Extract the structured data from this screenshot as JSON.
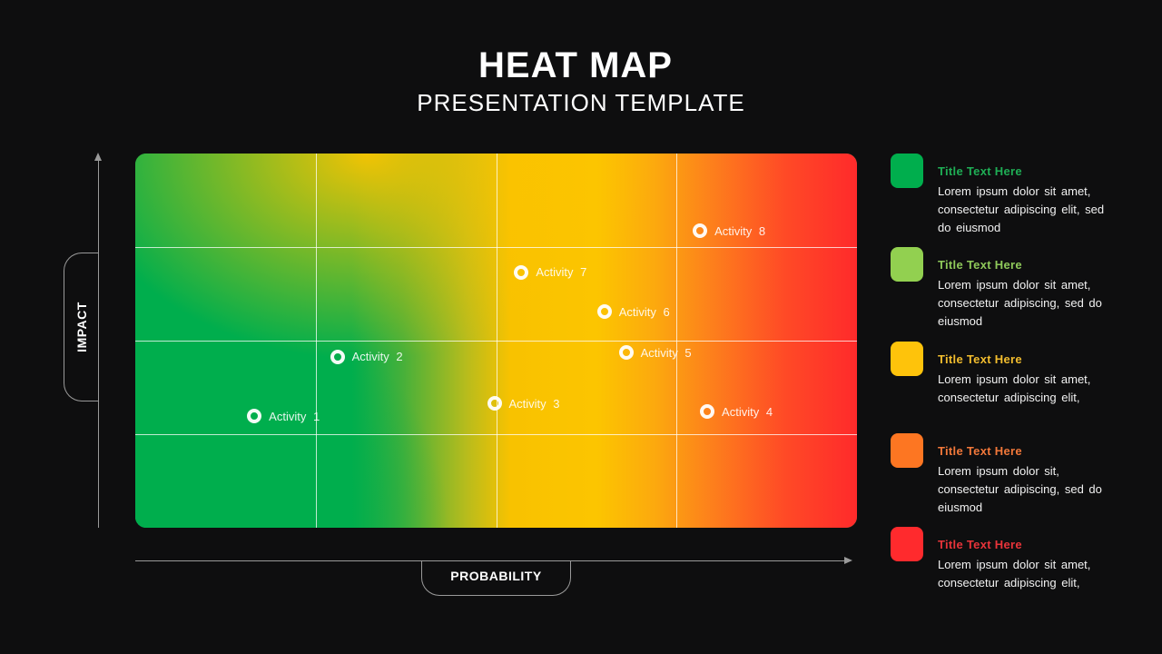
{
  "header": {
    "title": "HEAT MAP",
    "subtitle": "PRESENTATION TEMPLATE"
  },
  "chart_data": {
    "type": "heatmap",
    "title": "HEAT MAP",
    "subtitle": "PRESENTATION TEMPLATE",
    "xlabel": "PROBABILITY",
    "ylabel": "IMPACT",
    "xlim": [
      0,
      4
    ],
    "ylim": [
      0,
      4
    ],
    "grid": true,
    "grid_divisions": {
      "columns": 4,
      "rows": 4
    },
    "color_scale": [
      "#00ae4d",
      "#92d050",
      "#fcc200",
      "#fd7b22",
      "#ff2a2b"
    ],
    "color_direction": "green at low probability/low impact, red at high probability",
    "points": [
      {
        "label": "Activity 1",
        "x": 0.66,
        "y": 1.19
      },
      {
        "label": "Activity 2",
        "x": 1.12,
        "y": 1.83
      },
      {
        "label": "Activity 3",
        "x": 1.99,
        "y": 1.33
      },
      {
        "label": "Activity 4",
        "x": 3.17,
        "y": 1.24
      },
      {
        "label": "Activity 5",
        "x": 2.72,
        "y": 1.87
      },
      {
        "label": "Activity 6",
        "x": 2.6,
        "y": 2.31
      },
      {
        "label": "Activity 7",
        "x": 2.14,
        "y": 2.73
      },
      {
        "label": "Activity 8",
        "x": 3.13,
        "y": 3.17
      }
    ]
  },
  "legend": [
    {
      "title": "Title Text Here",
      "color": "#00ae4d",
      "title_color": "#1fae55",
      "text": "Lorem ipsum dolor sit amet, consectetur adipiscing elit, sed do eiusmod"
    },
    {
      "title": "Title Text Here",
      "color": "#92d050",
      "title_color": "#8fc95a",
      "text": "Lorem ipsum dolor sit amet, consectetur adipiscing, sed do eiusmod"
    },
    {
      "title": "Title Text Here",
      "color": "#fec30b",
      "title_color": "#f2bd2e",
      "text": "Lorem ipsum dolor sit amet, consectetur adipiscing elit,"
    },
    {
      "title": "Title Text Here",
      "color": "#fd7622",
      "title_color": "#f2783a",
      "text": "Lorem ipsum dolor sit, consectetur adipiscing, sed do eiusmod"
    },
    {
      "title": "Title Text Here",
      "color": "#ff2a2d",
      "title_color": "#e8343a",
      "text": "Lorem ipsum dolor sit amet, consectetur adipiscing elit,"
    }
  ]
}
